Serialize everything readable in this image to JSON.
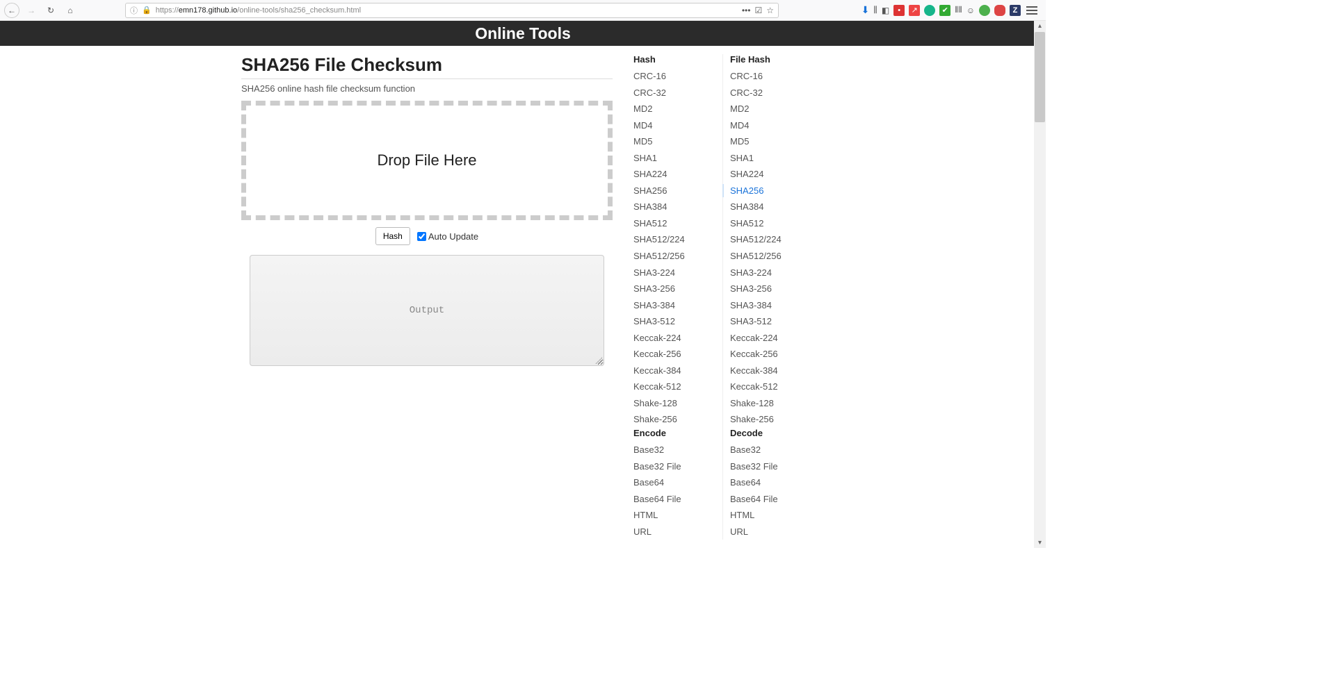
{
  "browser": {
    "url_prefix": "https://",
    "url_host": "emn178.github.io",
    "url_path": "/online-tools/sha256_checksum.html"
  },
  "banner_title": "Online Tools",
  "main": {
    "title": "SHA256 File Checksum",
    "subtitle": "SHA256 online hash file checksum function",
    "dropzone_text": "Drop File Here",
    "hash_button": "Hash",
    "auto_update_label": "Auto Update",
    "auto_update_checked": true,
    "output_placeholder": "Output"
  },
  "sidebar": {
    "columns": [
      {
        "heading": "Hash",
        "items": [
          "CRC-16",
          "CRC-32",
          "MD2",
          "MD4",
          "MD5",
          "SHA1",
          "SHA224",
          "SHA256",
          "SHA384",
          "SHA512",
          "SHA512/224",
          "SHA512/256",
          "SHA3-224",
          "SHA3-256",
          "SHA3-384",
          "SHA3-512",
          "Keccak-224",
          "Keccak-256",
          "Keccak-384",
          "Keccak-512",
          "Shake-128",
          "Shake-256"
        ],
        "active_index": null
      },
      {
        "heading": "File Hash",
        "items": [
          "CRC-16",
          "CRC-32",
          "MD2",
          "MD4",
          "MD5",
          "SHA1",
          "SHA224",
          "SHA256",
          "SHA384",
          "SHA512",
          "SHA512/224",
          "SHA512/256",
          "SHA3-224",
          "SHA3-256",
          "SHA3-384",
          "SHA3-512",
          "Keccak-224",
          "Keccak-256",
          "Keccak-384",
          "Keccak-512",
          "Shake-128",
          "Shake-256"
        ],
        "active_index": 7
      }
    ],
    "columns2": [
      {
        "heading": "Encode",
        "items": [
          "Base32",
          "Base32 File",
          "Base64",
          "Base64 File",
          "HTML",
          "URL"
        ]
      },
      {
        "heading": "Decode",
        "items": [
          "Base32",
          "Base32 File",
          "Base64",
          "Base64 File",
          "HTML",
          "URL"
        ]
      }
    ]
  }
}
